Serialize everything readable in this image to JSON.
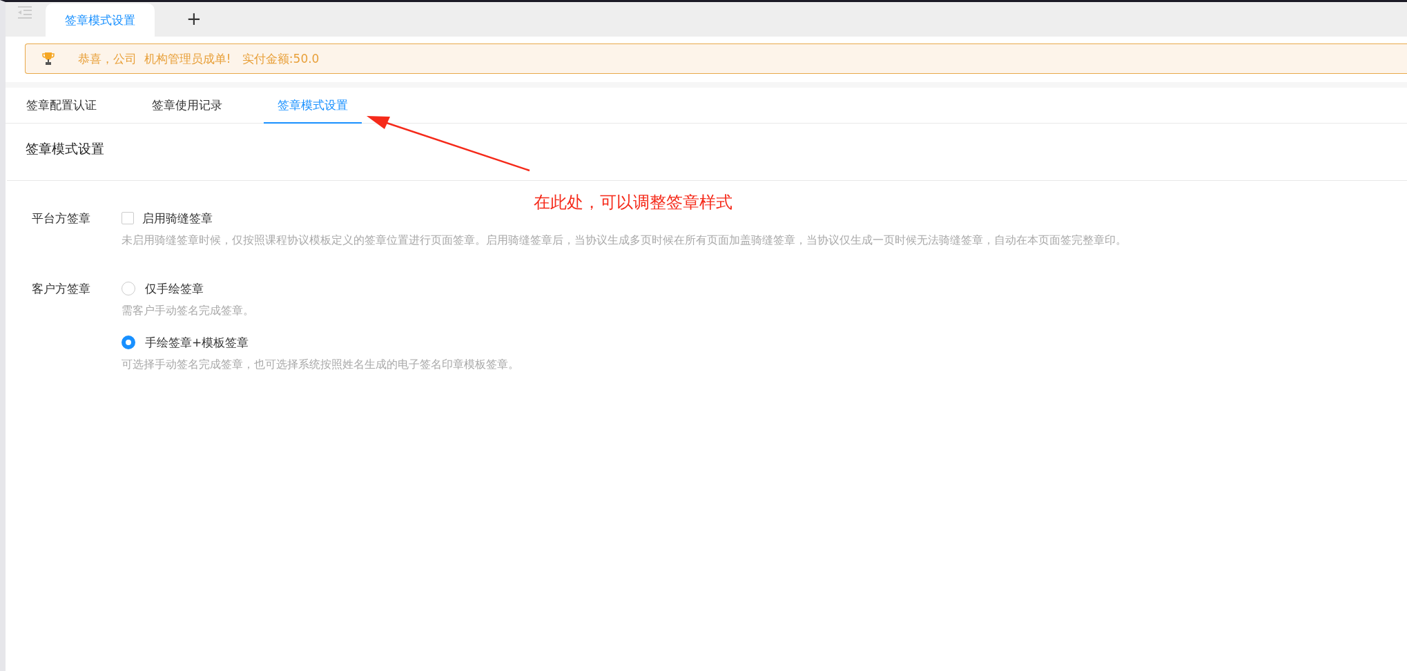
{
  "page_tabs": [
    {
      "label": "签章模式设置",
      "selected": true
    }
  ],
  "add_tab": "+",
  "notice": {
    "text": "恭喜，公司  机构管理员成单!   实付金额:50.0"
  },
  "tabs": [
    {
      "label": "签章配置认证",
      "selected": false
    },
    {
      "label": "签章使用记录",
      "selected": false
    },
    {
      "label": "签章模式设置",
      "selected": true
    }
  ],
  "section_title": "签章模式设置",
  "annotation": {
    "text": "在此处，可以调整签章样式"
  },
  "form": [
    {
      "label": "平台方签章",
      "options": [
        {
          "kind": "checkbox",
          "label": "启用骑缝签章",
          "checked": false,
          "description": "未启用骑缝签章时候，仅按照课程协议模板定义的签章位置进行页面签章。启用骑缝签章后，当协议生成多页时候在所有页面加盖骑缝签章，当协议仅生成一页时候无法骑缝签章，自动在本页面签完整章印。"
        }
      ]
    },
    {
      "label": "客户方签章",
      "options": [
        {
          "kind": "radio",
          "label": "仅手绘签章",
          "selected": false,
          "description": "需客户手动签名完成签章。"
        },
        {
          "kind": "radio",
          "label": "手绘签章+模板签章",
          "selected": true,
          "description": "可选择手动签名完成签章，也可选择系统按照姓名生成的电子签名印章模板签章。"
        }
      ]
    }
  ]
}
